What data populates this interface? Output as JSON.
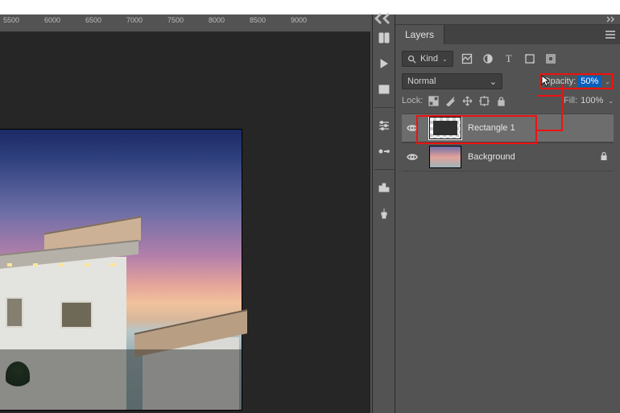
{
  "ruler": {
    "marks": [
      "5500",
      "6000",
      "6500",
      "7000",
      "7500",
      "8000",
      "8500",
      "9000"
    ]
  },
  "panel": {
    "tab_label": "Layers",
    "filter": {
      "kind_label": "Kind",
      "icons": [
        "pixel",
        "adjustment",
        "type",
        "shape",
        "smartobject"
      ]
    },
    "blend_mode": "Normal",
    "opacity_label": "Opacity:",
    "opacity_value": "50%",
    "fill_label": "Fill:",
    "fill_value": "100%",
    "lock_label": "Lock:"
  },
  "layers": [
    {
      "name": "Rectangle 1",
      "type": "shape",
      "selected": true,
      "locked": false
    },
    {
      "name": "Background",
      "type": "image",
      "selected": false,
      "locked": true
    }
  ]
}
